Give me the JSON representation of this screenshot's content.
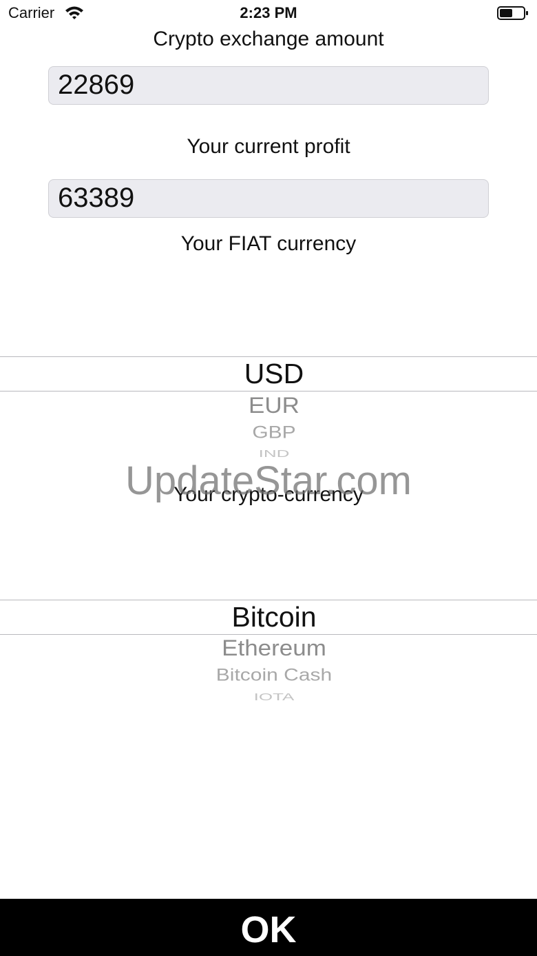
{
  "status_bar": {
    "carrier": "Carrier",
    "time": "2:23 PM",
    "wifi_icon": "wifi-icon",
    "battery_icon": "battery-icon"
  },
  "exchange": {
    "label": "Crypto exchange amount",
    "value": "22869"
  },
  "profit": {
    "label": "Your current profit",
    "value": "63389"
  },
  "fiat": {
    "label": "Your FIAT currency",
    "options": [
      "USD",
      "EUR",
      "GBP",
      "IND"
    ],
    "selected": "USD"
  },
  "crypto": {
    "label": "Your crypto-currency",
    "options": [
      "Bitcoin",
      "Ethereum",
      "Bitcoin Cash",
      "IOTA"
    ],
    "selected": "Bitcoin"
  },
  "watermark": "UpdateStar.com",
  "ok_button": {
    "label": "OK"
  },
  "colors": {
    "field_background": "#ebebf0",
    "ok_bar": "#000000",
    "ok_text": "#ffffff"
  }
}
